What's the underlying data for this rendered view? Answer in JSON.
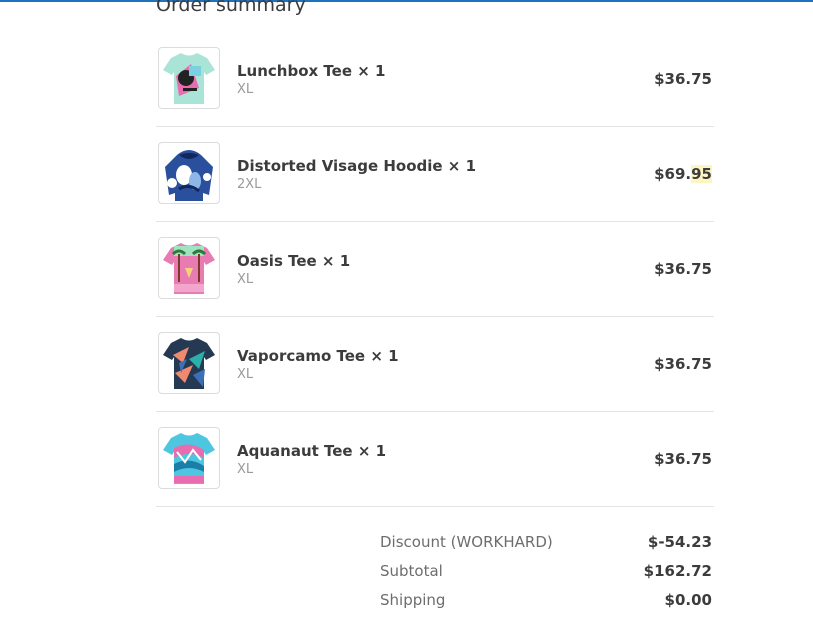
{
  "order_summary": {
    "heading": "Order summary",
    "items": [
      {
        "name": "Lunchbox Tee × 1",
        "variant": "XL",
        "price": "$36.75",
        "thumb_icon": "tshirt-lunchbox-icon",
        "colors": {
          "base": "#a9e4d6",
          "accent1": "#e86cb0",
          "accent2": "#222222",
          "accent3": "#7ad0e0"
        }
      },
      {
        "name": "Distorted Visage Hoodie × 1",
        "variant": "2XL",
        "price_main": "$69.",
        "price_highlight": "95",
        "thumb_icon": "hoodie-distorted-visage-icon",
        "colors": {
          "base": "#2a4f9c",
          "accent1": "#ffffff",
          "accent2": "#10285e",
          "accent3": "#8fb6e8"
        }
      },
      {
        "name": "Oasis Tee × 1",
        "variant": "XL",
        "price": "$36.75",
        "thumb_icon": "tshirt-oasis-icon",
        "colors": {
          "base": "#e77bb2",
          "accent1": "#9fe3c1",
          "accent2": "#7a3a2a",
          "accent3": "#f5d27a"
        }
      },
      {
        "name": "Vaporcamo Tee × 1",
        "variant": "XL",
        "price": "$36.75",
        "thumb_icon": "tshirt-vaporcamo-icon",
        "colors": {
          "base": "#253a52",
          "accent1": "#f08a6e",
          "accent2": "#2ab0a8",
          "accent3": "#3c6fb8"
        }
      },
      {
        "name": "Aquanaut Tee × 1",
        "variant": "XL",
        "price": "$36.75",
        "thumb_icon": "tshirt-aquanaut-icon",
        "colors": {
          "base": "#4fc6e0",
          "accent1": "#e86cb0",
          "accent2": "#1a7ea8",
          "accent3": "#ffffff"
        }
      }
    ]
  },
  "totals": {
    "discount_label": "Discount (WORKHARD)",
    "discount_value": "$-54.23",
    "subtotal_label": "Subtotal",
    "subtotal_value": "$162.72",
    "shipping_label": "Shipping",
    "shipping_value": "$0.00"
  },
  "colors": {
    "top_bar": "#1e73be",
    "text": "#3c3c3c",
    "muted": "#9a9a9a",
    "divider": "#e4e4e4",
    "highlight": "#fdf6c3"
  }
}
